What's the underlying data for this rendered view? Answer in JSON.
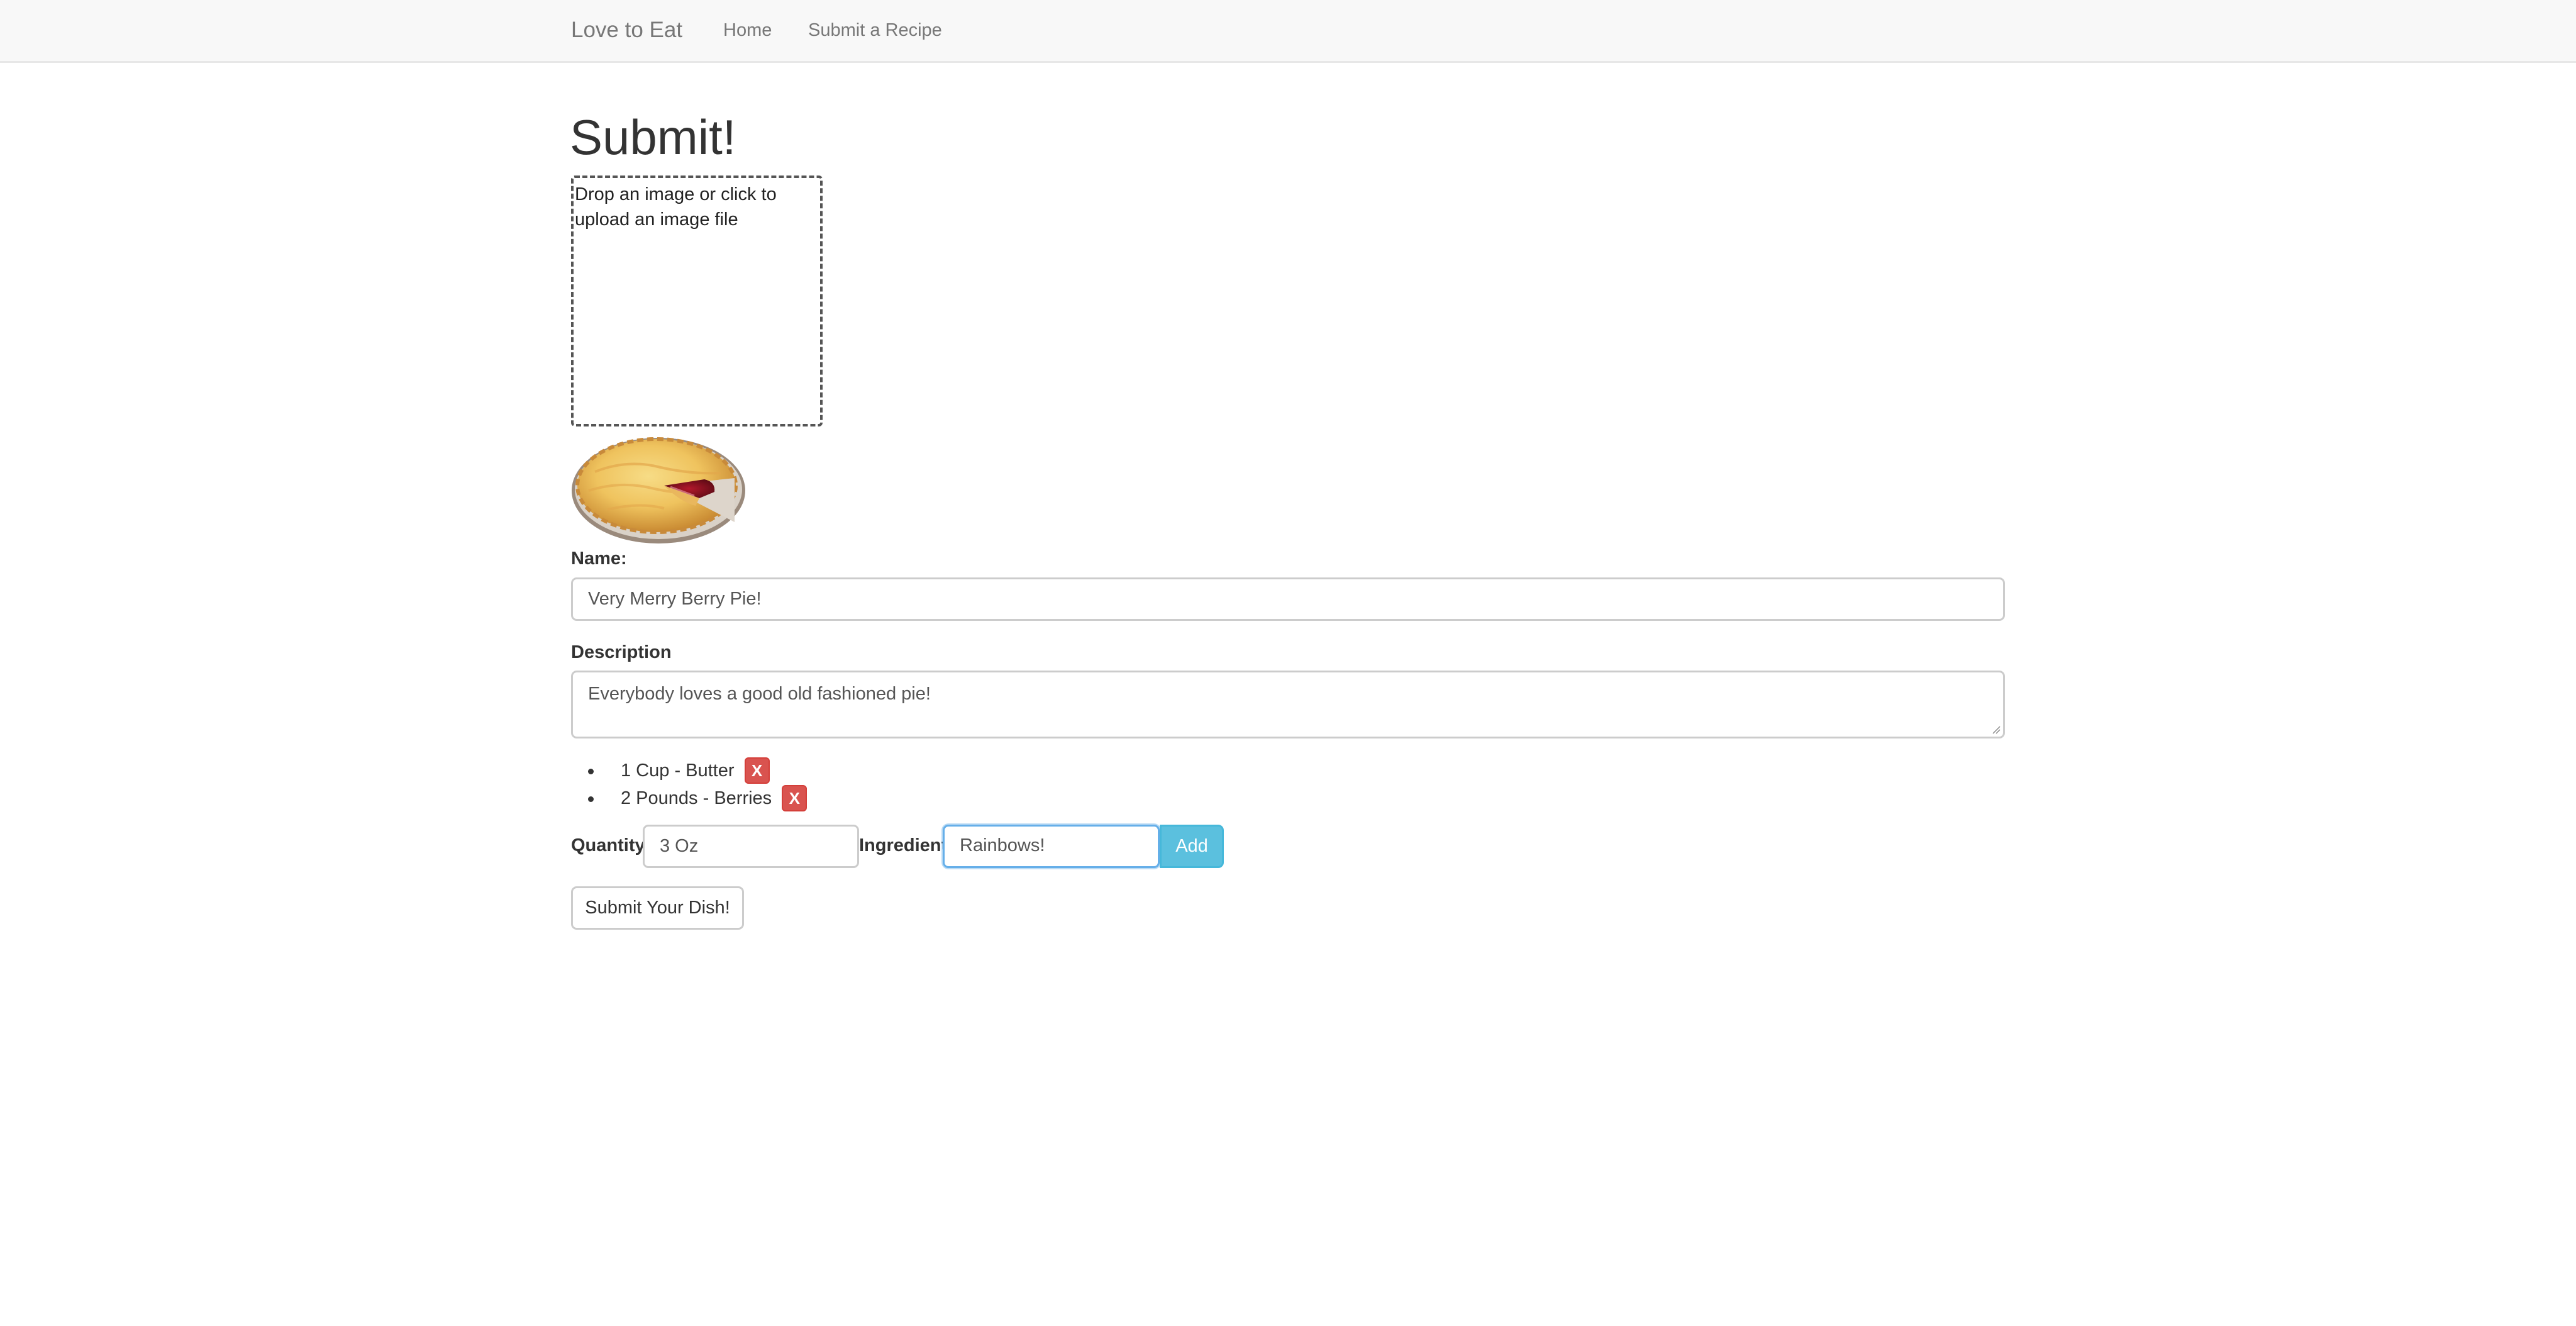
{
  "navbar": {
    "brand": "Love to Eat",
    "links": [
      {
        "label": "Home"
      },
      {
        "label": "Submit a Recipe"
      }
    ]
  },
  "page": {
    "title": "Submit!"
  },
  "dropzone": {
    "text": "Drop an image or click to upload an image file"
  },
  "preview": {
    "icon": "pie-image"
  },
  "form": {
    "name_label": "Name:",
    "name_value": "Very Merry Berry Pie!",
    "description_label": "Description",
    "description_value": "Everybody loves a good old fashioned pie!",
    "ingredients": [
      {
        "text": "1 Cup - Butter",
        "remove_label": "X"
      },
      {
        "text": "2 Pounds - Berries",
        "remove_label": "X"
      }
    ],
    "quantity_label": "Quantity",
    "quantity_value": "3 Oz",
    "ingredient_label": "Ingredient",
    "ingredient_value": "Rainbows!",
    "add_label": "Add",
    "submit_label": "Submit Your Dish!"
  },
  "colors": {
    "navbar_bg": "#f8f8f8",
    "remove_button": "#d9534f",
    "add_button": "#5bc0de",
    "focus_border": "#66afe9"
  }
}
